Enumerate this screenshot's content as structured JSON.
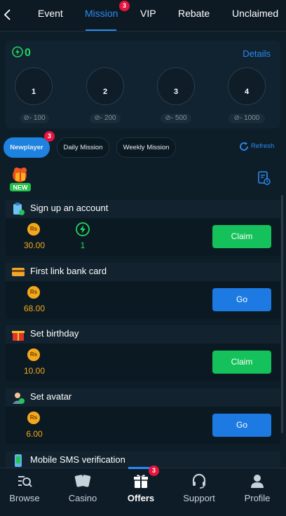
{
  "top_tabs": [
    {
      "label": "Event"
    },
    {
      "label": "Mission",
      "badge": "3"
    },
    {
      "label": "VIP"
    },
    {
      "label": "Rebate"
    },
    {
      "label": "Unclaimed"
    }
  ],
  "level_card": {
    "points": "0",
    "details_label": "Details",
    "levels": [
      {
        "level": "1",
        "threshold": "- 100"
      },
      {
        "level": "2",
        "threshold": "- 200"
      },
      {
        "level": "3",
        "threshold": "- 500"
      },
      {
        "level": "4",
        "threshold": "- 1000"
      }
    ]
  },
  "filters": {
    "items": [
      {
        "label": "Newplayer",
        "badge": "3",
        "active": true
      },
      {
        "label": "Daily Mission"
      },
      {
        "label": "Weekly Mission"
      }
    ],
    "refresh_label": "Refresh"
  },
  "new_label": "NEW",
  "tasks": [
    {
      "title": "Sign up an account",
      "currency": "Rs",
      "reward": "30.00",
      "points": "1",
      "action": "Claim"
    },
    {
      "title": "First link bank card",
      "currency": "Rs",
      "reward": "68.00",
      "action": "Go"
    },
    {
      "title": "Set birthday",
      "currency": "Rs",
      "reward": "10.00",
      "action": "Claim"
    },
    {
      "title": "Set avatar",
      "currency": "Rs",
      "reward": "6.00",
      "action": "Go"
    },
    {
      "title": "Mobile SMS verification"
    }
  ],
  "bottom_nav": [
    {
      "label": "Browse"
    },
    {
      "label": "Casino"
    },
    {
      "label": "Offers",
      "badge": "3",
      "active": true
    },
    {
      "label": "Support"
    },
    {
      "label": "Profile"
    }
  ],
  "colors": {
    "accent_blue": "#2a8bf2",
    "claim_green": "#14c15a",
    "go_blue": "#1d7ae3",
    "coin_orange": "#f3a81c",
    "points_green": "#24d55f",
    "badge_red": "#e8143e"
  }
}
